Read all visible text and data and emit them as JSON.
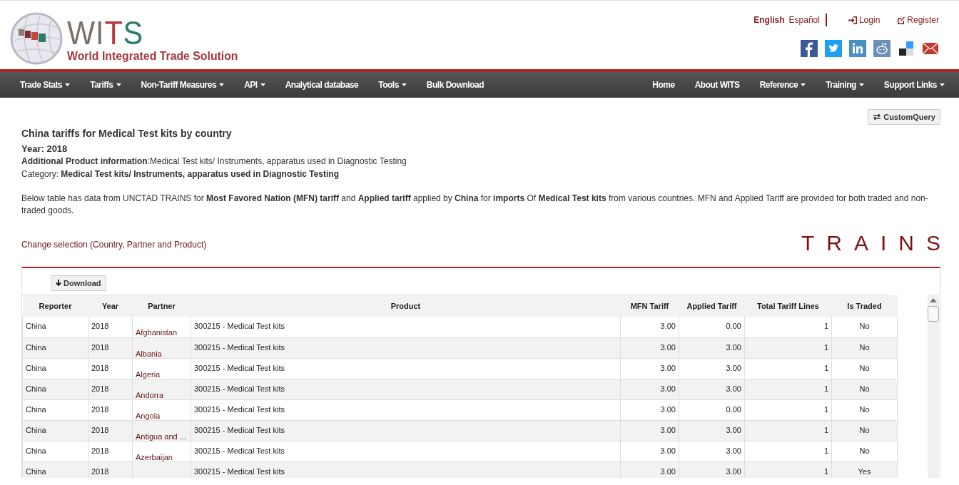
{
  "header": {
    "wordmark": [
      {
        "text": "WI",
        "color": "#7d6e68"
      },
      {
        "text": "T",
        "color": "#b2393b"
      },
      {
        "text": "S",
        "color": "#2f7a68"
      }
    ],
    "tagline": "World Integrated Trade Solution",
    "languages": [
      {
        "label": "English",
        "selected": true
      },
      {
        "label": "Español",
        "selected": false
      }
    ],
    "account_links": [
      {
        "kind": "login",
        "label": "Login"
      },
      {
        "kind": "register",
        "label": "Register"
      }
    ],
    "social": [
      {
        "kind": "facebook"
      },
      {
        "kind": "twitter"
      },
      {
        "kind": "linkedin"
      },
      {
        "kind": "reddit"
      },
      {
        "kind": "delicious"
      },
      {
        "kind": "email"
      }
    ]
  },
  "nav": {
    "left": [
      {
        "label": "Trade Stats",
        "dropdown": true
      },
      {
        "label": "Tariffs",
        "dropdown": true
      },
      {
        "label": "Non-Tariff Measures",
        "dropdown": true
      },
      {
        "label": "API",
        "dropdown": true
      },
      {
        "label": "Analytical database",
        "dropdown": false
      },
      {
        "label": "Tools",
        "dropdown": true
      },
      {
        "label": "Bulk Download",
        "dropdown": false
      }
    ],
    "right": [
      {
        "label": "Home",
        "dropdown": false
      },
      {
        "label": "About WITS",
        "dropdown": false
      },
      {
        "label": "Reference",
        "dropdown": true
      },
      {
        "label": "Training",
        "dropdown": true
      },
      {
        "label": "Support Links",
        "dropdown": true
      }
    ]
  },
  "custom_query_button": "CustomQuery",
  "title": "China tariffs for Medical Test kits by country",
  "year": "Year: 2018",
  "additional_info": "**Additional Product information**:Medical Test kits/ Instruments, apparatus used in Diagnostic Testing",
  "category": "Category: **Medical Test kits/ Instruments, apparatus used in Diagnostic Testing**",
  "description": "Below table has data from UNCTAD TRAINS for **Most Favored Nation (MFN) tariff** and **Applied tariff** applied by **China** for **imports** Of **Medical Test kits** from various countries. MFN and Applied Tariff are provided for both traded and non-traded goods.",
  "change_selection_link": "Change selection (Country, Partner and Product)",
  "source_logo": "TRAINS",
  "download_button": "Download",
  "table": {
    "columns": [
      "Reporter",
      "Year",
      "Partner",
      "Product",
      "MFN Tariff",
      "Applied Tariff",
      "Total Tariff Lines",
      "Is Traded"
    ],
    "rows": [
      {
        "reporter": "China",
        "year": "2018",
        "partner": "Afghanistan",
        "product": "300215 - Medical Test kits",
        "mfn": "3.00",
        "applied": "0.00",
        "lines": "1",
        "traded": "No"
      },
      {
        "reporter": "China",
        "year": "2018",
        "partner": "Albania",
        "product": "300215 - Medical Test kits",
        "mfn": "3.00",
        "applied": "3.00",
        "lines": "1",
        "traded": "No"
      },
      {
        "reporter": "China",
        "year": "2018",
        "partner": "Algeria",
        "product": "300215 - Medical Test kits",
        "mfn": "3.00",
        "applied": "3.00",
        "lines": "1",
        "traded": "No"
      },
      {
        "reporter": "China",
        "year": "2018",
        "partner": "Andorra",
        "product": "300215 - Medical Test kits",
        "mfn": "3.00",
        "applied": "3.00",
        "lines": "1",
        "traded": "No"
      },
      {
        "reporter": "China",
        "year": "2018",
        "partner": "Angola",
        "product": "300215 - Medical Test kits",
        "mfn": "3.00",
        "applied": "0.00",
        "lines": "1",
        "traded": "No"
      },
      {
        "reporter": "China",
        "year": "2018",
        "partner": "Antigua and ...",
        "product": "300215 - Medical Test kits",
        "mfn": "3.00",
        "applied": "3.00",
        "lines": "1",
        "traded": "No"
      },
      {
        "reporter": "China",
        "year": "2018",
        "partner": "Azerbaijan",
        "product": "300215 - Medical Test kits",
        "mfn": "3.00",
        "applied": "3.00",
        "lines": "1",
        "traded": "No"
      },
      {
        "reporter": "China",
        "year": "2018",
        "product": "300215 - Medical Test kits",
        "mfn": "3.00",
        "applied": "3.00",
        "lines": "1",
        "traded": "Yes"
      }
    ]
  }
}
